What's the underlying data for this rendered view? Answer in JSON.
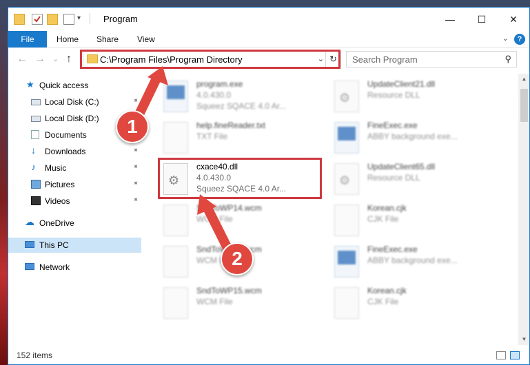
{
  "window": {
    "title": "Program",
    "minimize_glyph": "—",
    "maximize_glyph": "☐",
    "close_glyph": "✕"
  },
  "ribbon": {
    "tabs": [
      "File",
      "Home",
      "Share",
      "View"
    ],
    "help_glyph": "?",
    "expand_glyph": "⌄"
  },
  "nav": {
    "back_glyph": "←",
    "forward_glyph": "→",
    "recent_glyph": "⌄",
    "up_glyph": "↑",
    "address": "C:\\Program Files\\Program Directory",
    "address_dropdown_glyph": "⌄",
    "refresh_glyph": "↻",
    "search_placeholder": "Search Program",
    "search_glyph": "⚲"
  },
  "sidebar": {
    "items": [
      {
        "label": "Quick access",
        "icon": "star-icon",
        "pinned": false
      },
      {
        "label": "Local Disk (C:)",
        "icon": "drive-icon",
        "pinned": true
      },
      {
        "label": "Local Disk (D:)",
        "icon": "drive-icon",
        "pinned": false
      },
      {
        "label": "Documents",
        "icon": "documents-icon",
        "pinned": true
      },
      {
        "label": "Downloads",
        "icon": "downloads-icon",
        "pinned": true
      },
      {
        "label": "Music",
        "icon": "music-icon",
        "pinned": true
      },
      {
        "label": "Pictures",
        "icon": "pictures-icon",
        "pinned": true
      },
      {
        "label": "Videos",
        "icon": "videos-icon",
        "pinned": true
      },
      {
        "label": "OneDrive",
        "icon": "cloud-icon",
        "pinned": false
      },
      {
        "label": "This PC",
        "icon": "computer-icon",
        "pinned": false
      },
      {
        "label": "Network",
        "icon": "network-icon",
        "pinned": false
      }
    ],
    "selected": "This PC",
    "pin_glyph": "📌"
  },
  "files": [
    {
      "name": "program.exe",
      "line1": "4.0.430.0",
      "line2": "Squeez SQACE 4.0 Ar...",
      "icon": "exe"
    },
    {
      "name": "UpdateClient21.dll",
      "line1": "Resource DLL",
      "line2": "",
      "icon": "dll"
    },
    {
      "name": "help.fineReader.txt",
      "line1": "TXT File",
      "line2": "",
      "icon": "txt"
    },
    {
      "name": "FineExec.exe",
      "line1": "ABBY background exe...",
      "line2": "",
      "icon": "exe"
    },
    {
      "name": "cxace40.dll",
      "line1": "4.0.430.0",
      "line2": "Squeez SQACE 4.0 Ar...",
      "icon": "dll"
    },
    {
      "name": "UpdateClient65.dll",
      "line1": "Resource DLL",
      "line2": "",
      "icon": "dll"
    },
    {
      "name": "SndToWP14.wcm",
      "line1": "WCM File",
      "line2": "",
      "icon": "file"
    },
    {
      "name": "Korean.cjk",
      "line1": "CJK File",
      "line2": "",
      "icon": "file"
    },
    {
      "name": "SndToWP13.wcm",
      "line1": "WCM File",
      "line2": "",
      "icon": "file"
    },
    {
      "name": "FineExec.exe",
      "line1": "ABBY background exe...",
      "line2": "",
      "icon": "exe"
    },
    {
      "name": "SndToWP15.wcm",
      "line1": "WCM File",
      "line2": "",
      "icon": "file"
    },
    {
      "name": "Korean.cjk",
      "line1": "CJK File",
      "line2": "",
      "icon": "file"
    }
  ],
  "highlighted_file": "cxace40.dll",
  "status": {
    "item_count": "152 items"
  },
  "scrollbar": {
    "up_glyph": "▲",
    "down_glyph": "▼"
  },
  "annotations": {
    "step1": "1",
    "step2": "2",
    "color": "#e0473f"
  }
}
